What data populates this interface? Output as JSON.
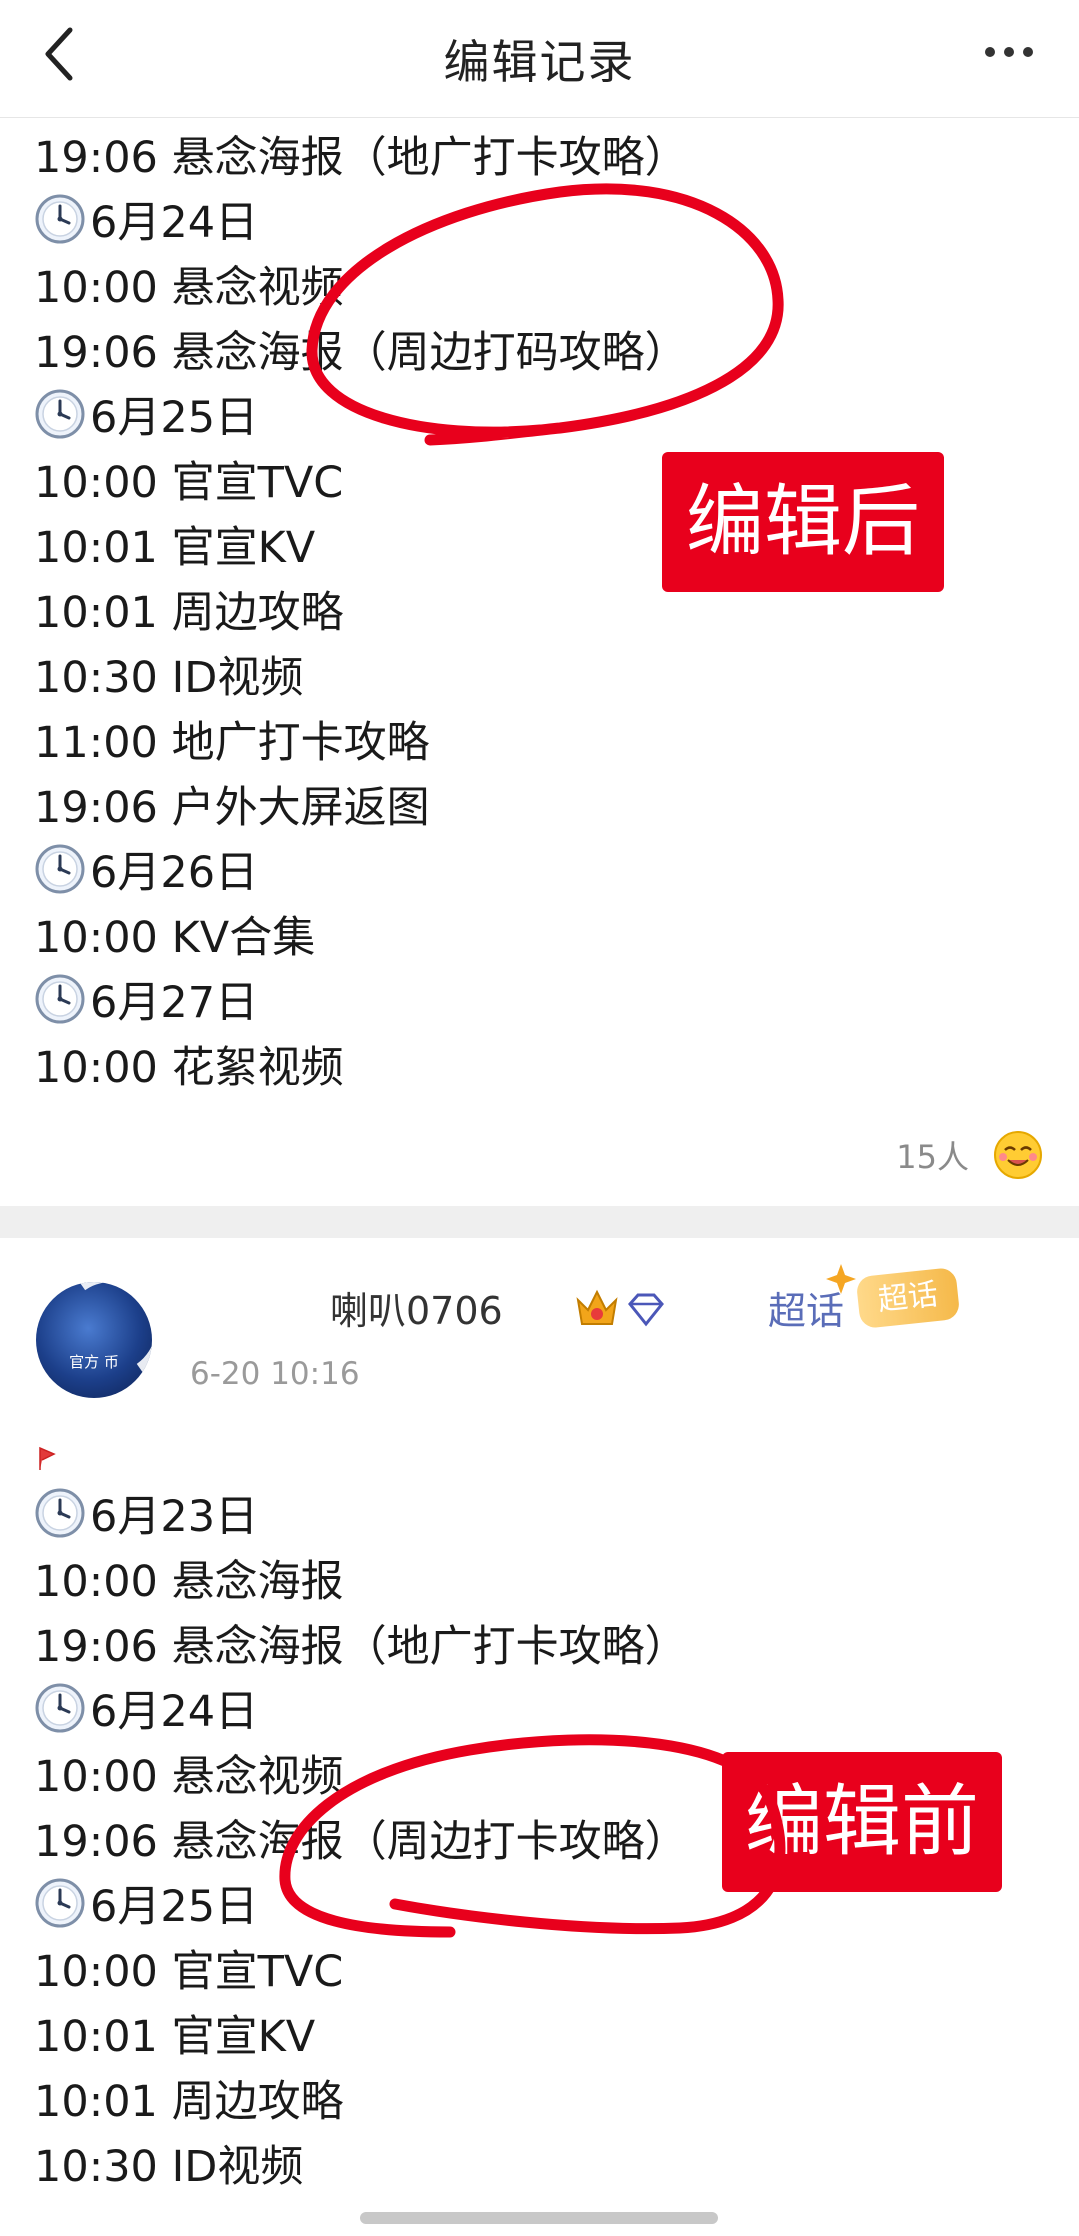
{
  "nav": {
    "title": "编辑记录"
  },
  "after_post": {
    "lines": [
      {
        "clock": false,
        "text": "19:06 悬念海报（地广打卡攻略）"
      },
      {
        "clock": true,
        "text": "6月24日"
      },
      {
        "clock": false,
        "text": "10:00 悬念视频"
      },
      {
        "clock": false,
        "text": "19:06 悬念海报（周边打码攻略）"
      },
      {
        "clock": true,
        "text": "6月25日"
      },
      {
        "clock": false,
        "text": "10:00 官宣TVC"
      },
      {
        "clock": false,
        "text": "10:01 官宣KV"
      },
      {
        "clock": false,
        "text": "10:01 周边攻略"
      },
      {
        "clock": false,
        "text": "10:30 ID视频"
      },
      {
        "clock": false,
        "text": "11:00 地广打卡攻略"
      },
      {
        "clock": false,
        "text": "19:06 户外大屏返图"
      },
      {
        "clock": true,
        "text": "6月26日"
      },
      {
        "clock": false,
        "text": "10:00 KV合集"
      },
      {
        "clock": true,
        "text": "6月27日"
      },
      {
        "clock": false,
        "text": "10:00 花絮视频"
      }
    ],
    "like_count": "15人",
    "annotation_label": "编辑后"
  },
  "before_post": {
    "author": {
      "name": "喇叭0706",
      "supertopic": "超话",
      "supertopic_badge": "超话",
      "avatar_text": "官方  币"
    },
    "time": "6-20 10:16",
    "lines": [
      {
        "clock": true,
        "text": "6月23日"
      },
      {
        "clock": false,
        "text": "10:00 悬念海报"
      },
      {
        "clock": false,
        "text": "19:06 悬念海报（地广打卡攻略）"
      },
      {
        "clock": true,
        "text": "6月24日"
      },
      {
        "clock": false,
        "text": "10:00 悬念视频"
      },
      {
        "clock": false,
        "text": "19:06 悬念海报（周边打卡攻略）"
      },
      {
        "clock": true,
        "text": "6月25日"
      },
      {
        "clock": false,
        "text": "10:00 官宣TVC"
      },
      {
        "clock": false,
        "text": "10:01 官宣KV"
      },
      {
        "clock": false,
        "text": "10:01 周边攻略"
      },
      {
        "clock": false,
        "text": "10:30 ID视频"
      }
    ],
    "annotation_label": "编辑前"
  },
  "colors": {
    "annotation_red": "#e8001c",
    "link_blue": "#5a6db8",
    "muted_gray": "#8a8a8a"
  },
  "icons": {
    "back": "chevron-left-icon",
    "more": "more-dots-icon",
    "clock": "clock-icon",
    "like": "emoji-icon",
    "crown": "crown-icon",
    "gem": "diamond-icon"
  }
}
